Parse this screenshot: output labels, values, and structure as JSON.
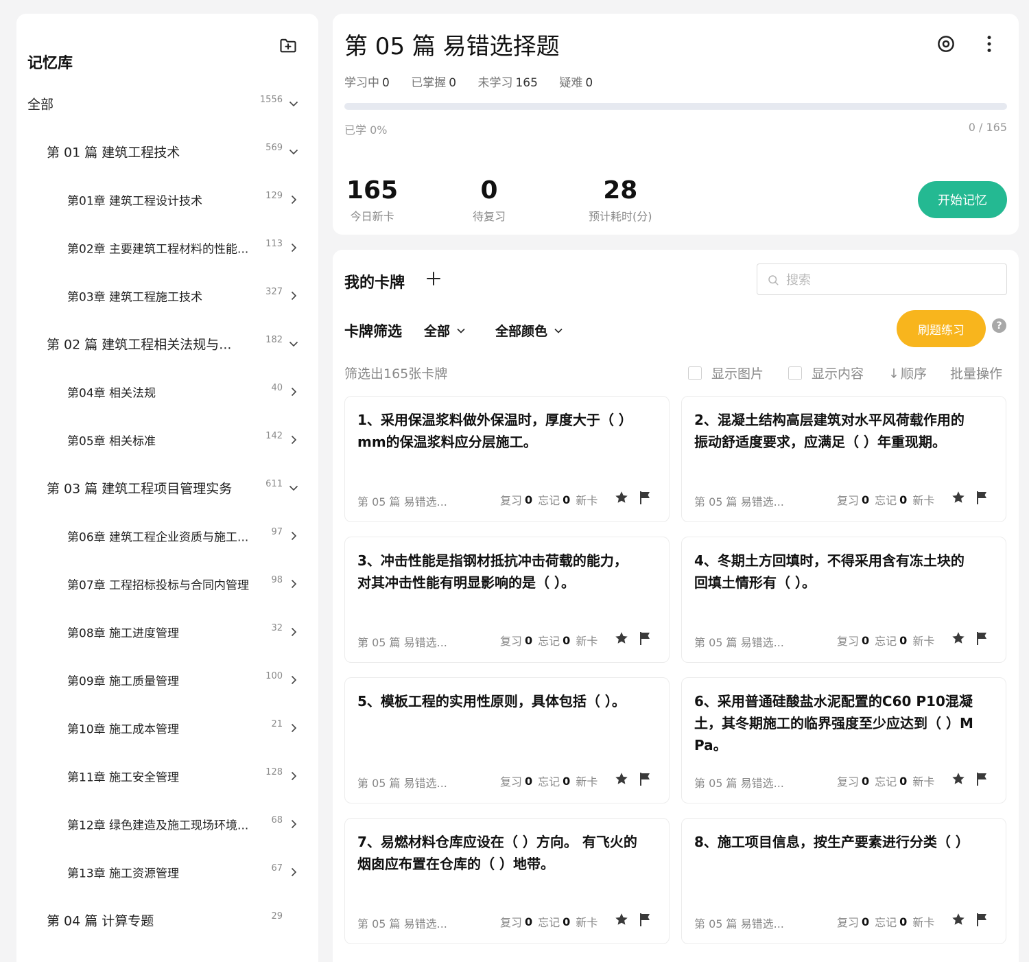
{
  "sidebar": {
    "title": "记忆库",
    "add_icon": "add-folder-icon",
    "tree": [
      {
        "label": "全部",
        "count": "1556",
        "level": 0,
        "chevron": "down"
      },
      {
        "label": "第 01 篇 建筑工程技术",
        "count": "569",
        "level": 1,
        "chevron": "down"
      },
      {
        "label": "第01章 建筑工程设计技术",
        "count": "129",
        "level": 2,
        "chevron": "right"
      },
      {
        "label": "第02章 主要建筑工程材料的性能...",
        "count": "113",
        "level": 2,
        "chevron": "right"
      },
      {
        "label": "第03章 建筑工程施工技术",
        "count": "327",
        "level": 2,
        "chevron": "right"
      },
      {
        "label": "第 02 篇 建筑工程相关法规与...",
        "count": "182",
        "level": 1,
        "chevron": "down"
      },
      {
        "label": "第04章 相关法规",
        "count": "40",
        "level": 2,
        "chevron": "right"
      },
      {
        "label": "第05章 相关标准",
        "count": "142",
        "level": 2,
        "chevron": "right"
      },
      {
        "label": "第 03 篇 建筑工程项目管理实务",
        "count": "611",
        "level": 1,
        "chevron": "down"
      },
      {
        "label": "第06章 建筑工程企业资质与施工...",
        "count": "97",
        "level": 2,
        "chevron": "right"
      },
      {
        "label": "第07章 工程招标投标与合同内管理",
        "count": "98",
        "level": 2,
        "chevron": "right"
      },
      {
        "label": "第08章 施工进度管理",
        "count": "32",
        "level": 2,
        "chevron": "right"
      },
      {
        "label": "第09章 施工质量管理",
        "count": "100",
        "level": 2,
        "chevron": "right"
      },
      {
        "label": "第10章 施工成本管理",
        "count": "21",
        "level": 2,
        "chevron": "right"
      },
      {
        "label": "第11章 施工安全管理",
        "count": "128",
        "level": 2,
        "chevron": "right"
      },
      {
        "label": "第12章 绿色建造及施工现场环境...",
        "count": "68",
        "level": 2,
        "chevron": "right"
      },
      {
        "label": "第13章 施工资源管理",
        "count": "67",
        "level": 2,
        "chevron": "right"
      },
      {
        "label": "第 04 篇 计算专题",
        "count": "29",
        "level": 1,
        "chevron": "none"
      }
    ]
  },
  "header": {
    "title": "第 05 篇 易错选择题",
    "icons": {
      "target": "target-icon",
      "more": "more-vertical-icon"
    },
    "stats": [
      {
        "label": "学习中",
        "value": "0"
      },
      {
        "label": "已掌握",
        "value": "0"
      },
      {
        "label": "未学习",
        "value": "165"
      },
      {
        "label": "疑难",
        "value": "0"
      }
    ],
    "progress_fraction": 0,
    "learned_text": "已学 0%",
    "ratio_text": "0 / 165",
    "big_stats": [
      {
        "num": "165",
        "caption": "今日新卡"
      },
      {
        "num": "0",
        "caption": "待复习"
      },
      {
        "num": "28",
        "caption": "预计耗时(分)"
      }
    ],
    "start_label": "开始记忆",
    "accent_color": "#24b992"
  },
  "cards_panel": {
    "title": "我的卡牌",
    "add_icon": "plus-icon",
    "search_placeholder": "搜索",
    "filter_label": "卡牌筛选",
    "filter_all": "全部",
    "filter_color": "全部颜色",
    "practice_label": "刷题练习",
    "practice_color": "#f8b51d",
    "help": "?",
    "filtered_text": "筛选出165张卡牌",
    "show_image": "显示图片",
    "show_content": "显示内容",
    "order": "顺序",
    "batch": "批量操作",
    "cards": [
      {
        "question": "1、采用保温浆料做外保温时，厚度大于（ ）mm的保温浆料应分层施工。",
        "deck": "第 05 篇 易错选...",
        "review_label": "复习",
        "review": "0",
        "forget_label": "忘记",
        "forget": "0",
        "status": "新卡"
      },
      {
        "question": "2、混凝土结构高层建筑对水平风荷载作用的振动舒适度要求，应满足（ ）年重现期。",
        "deck": "第 05 篇 易错选...",
        "review_label": "复习",
        "review": "0",
        "forget_label": "忘记",
        "forget": "0",
        "status": "新卡"
      },
      {
        "question": "3、冲击性能是指钢材抵抗冲击荷载的能力，对其冲击性能有明显影响的是（ ）。",
        "deck": "第 05 篇 易错选...",
        "review_label": "复习",
        "review": "0",
        "forget_label": "忘记",
        "forget": "0",
        "status": "新卡"
      },
      {
        "question": "4、冬期土方回填时，不得采用含有冻土块的回填土情形有（ ）。",
        "deck": "第 05 篇 易错选...",
        "review_label": "复习",
        "review": "0",
        "forget_label": "忘记",
        "forget": "0",
        "status": "新卡"
      },
      {
        "question": "5、模板工程的实用性原则，具体包括（ ）。",
        "deck": "第 05 篇 易错选...",
        "review_label": "复习",
        "review": "0",
        "forget_label": "忘记",
        "forget": "0",
        "status": "新卡"
      },
      {
        "question": "6、采用普通硅酸盐水泥配置的C60 P10混凝土，其冬期施工的临界强度至少应达到（ ）MPa。",
        "deck": "第 05 篇 易错选...",
        "review_label": "复习",
        "review": "0",
        "forget_label": "忘记",
        "forget": "0",
        "status": "新卡"
      },
      {
        "question": "7、易燃材料仓库应设在（ ）方向。 有飞火的烟囱应布置在仓库的（ ）地带。",
        "deck": "第 05 篇 易错选...",
        "review_label": "复习",
        "review": "0",
        "forget_label": "忘记",
        "forget": "0",
        "status": "新卡"
      },
      {
        "question": "8、施工项目信息，按生产要素进行分类（ ）",
        "deck": "第 05 篇 易错选...",
        "review_label": "复习",
        "review": "0",
        "forget_label": "忘记",
        "forget": "0",
        "status": "新卡"
      }
    ]
  }
}
